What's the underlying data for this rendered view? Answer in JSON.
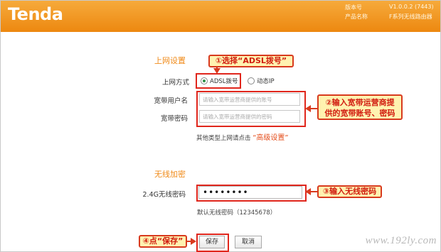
{
  "header": {
    "logo": "Tenda",
    "version_label": "版本号",
    "version_value": "V1.0.0.2 (7443)",
    "product_label": "产品名称",
    "product_value": "F系列无线路由器"
  },
  "internet": {
    "section_title": "上网设置",
    "mode_label": "上网方式",
    "option_adsl": "ADSL拨号",
    "option_dhcp": "动态IP",
    "selected": "ADSL拨号",
    "username_label": "宽带用户名",
    "username_placeholder": "请输入宽带运营商提供的账号",
    "password_label": "宽带密码",
    "password_placeholder": "请输入宽带运营商提供的密码",
    "other_type_prefix": "其他类型上网请点击",
    "advanced_link": "“高级设置”"
  },
  "wireless": {
    "section_title": "无线加密",
    "password_label": "2.4G无线密码",
    "password_value": "••••••••",
    "default_note": "默认无线密码（12345678）"
  },
  "buttons": {
    "save": "保存",
    "cancel": "取消"
  },
  "annotations": {
    "step1": "①选择“ADSL拨号”",
    "step2_line1": "②输入宽带运营商提",
    "step2_line2": "供的宽带账号、密码",
    "step3": "③输入无线密码",
    "step4": "④点“保存”"
  },
  "watermark": "www.192ly.com",
  "colors": {
    "header_orange": "#ee8d15",
    "section_title": "#f08a18",
    "annotation_red": "#e0261c",
    "callout_fill": "#fff2b0"
  }
}
